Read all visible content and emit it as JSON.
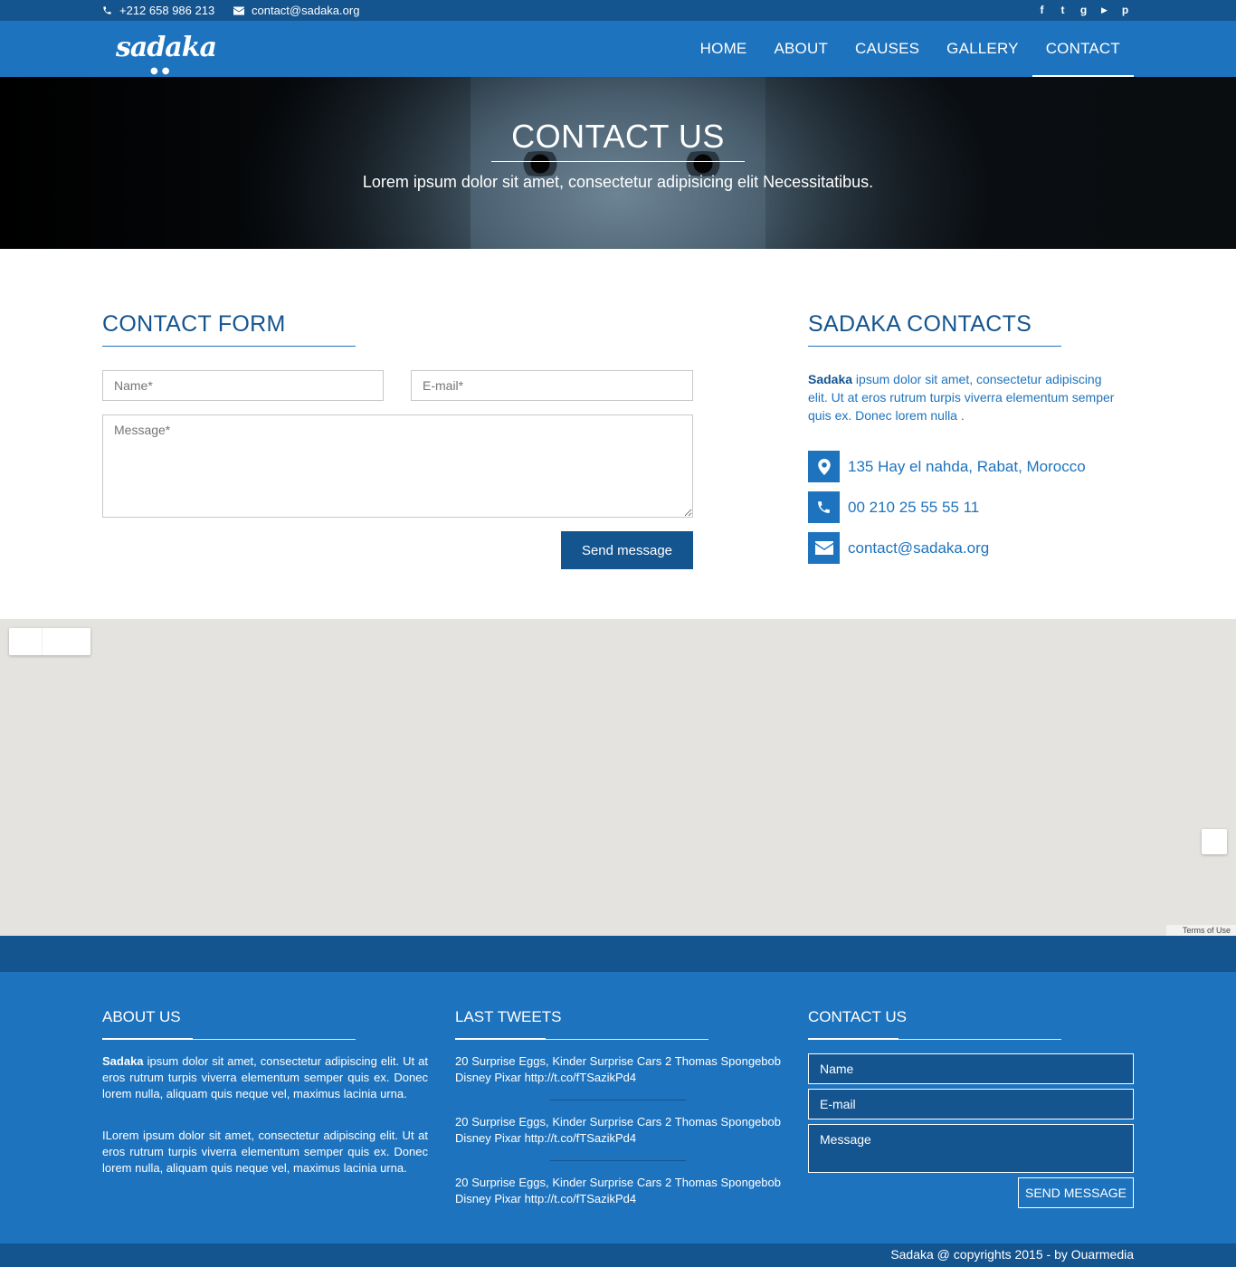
{
  "topbar": {
    "phone": "+212 658 986 213",
    "email": "contact@sadaka.org",
    "social": [
      {
        "icon": "facebook-icon",
        "glyph": "f"
      },
      {
        "icon": "twitter-icon",
        "glyph": "t"
      },
      {
        "icon": "google-plus-icon",
        "glyph": "g"
      },
      {
        "icon": "youtube-icon",
        "glyph": "▶"
      },
      {
        "icon": "pinterest-icon",
        "glyph": "p"
      }
    ]
  },
  "nav": {
    "logo": "sadaka",
    "items": [
      "HOME",
      "ABOUT",
      "CAUSES",
      "GALLERY",
      "CONTACT"
    ],
    "active": "CONTACT"
  },
  "hero": {
    "title": "CONTACT US",
    "subtitle": "Lorem ipsum dolor sit amet, consectetur adipisicing elit Necessitatibus."
  },
  "contact_form": {
    "title": "CONTACT FORM",
    "name_placeholder": "Name*",
    "email_placeholder": "E-mail*",
    "message_placeholder": "Message*",
    "send_label": "Send message"
  },
  "sadaka_contacts": {
    "title": "SADAKA CONTACTS",
    "about_bold": "Sadaka",
    "about_text": " ipsum dolor sit amet, consectetur adipiscing elit. Ut at eros rutrum turpis viverra elementum semper quis ex. Donec lorem nulla .",
    "address": "135 Hay el nahda, Rabat, Morocco",
    "phone": "00 210 25 55 55 11",
    "email": "contact@sadaka.org"
  },
  "map": {
    "terms": "Terms of Use"
  },
  "footer": {
    "about": {
      "title": "ABOUT US",
      "p1_bold": "Sadaka",
      "p1_text": " ipsum dolor sit amet, consectetur adipiscing elit. Ut at eros rutrum turpis viverra elementum semper quis ex. Donec lorem nulla, aliquam quis neque vel, maximus lacinia urna.",
      "p2": "ILorem ipsum dolor sit amet, consectetur adipiscing elit. Ut at eros rutrum turpis viverra elementum semper quis ex. Donec lorem nulla, aliquam quis neque vel, maximus lacinia urna."
    },
    "tweets": {
      "title": "LAST TWEETS",
      "items": [
        "20 Surprise Eggs, Kinder Surprise Cars 2 Thomas Spongebob Disney Pixar http://t.co/fTSazikPd4",
        "20 Surprise Eggs, Kinder Surprise Cars 2 Thomas Spongebob Disney Pixar http://t.co/fTSazikPd4",
        "20 Surprise Eggs, Kinder Surprise Cars 2 Thomas Spongebob Disney Pixar http://t.co/fTSazikPd4"
      ]
    },
    "contact": {
      "title": "CONTACT US",
      "name_placeholder": "Name",
      "email_placeholder": "E-mail",
      "message_placeholder": "Message",
      "send_label": "SEND MESSAGE"
    }
  },
  "copyright": "Sadaka @ copyrights 2015 - by Ouarmedia",
  "colors": {
    "primary": "#1e73be",
    "dark": "#14548f",
    "map_bg": "#e5e3df"
  }
}
